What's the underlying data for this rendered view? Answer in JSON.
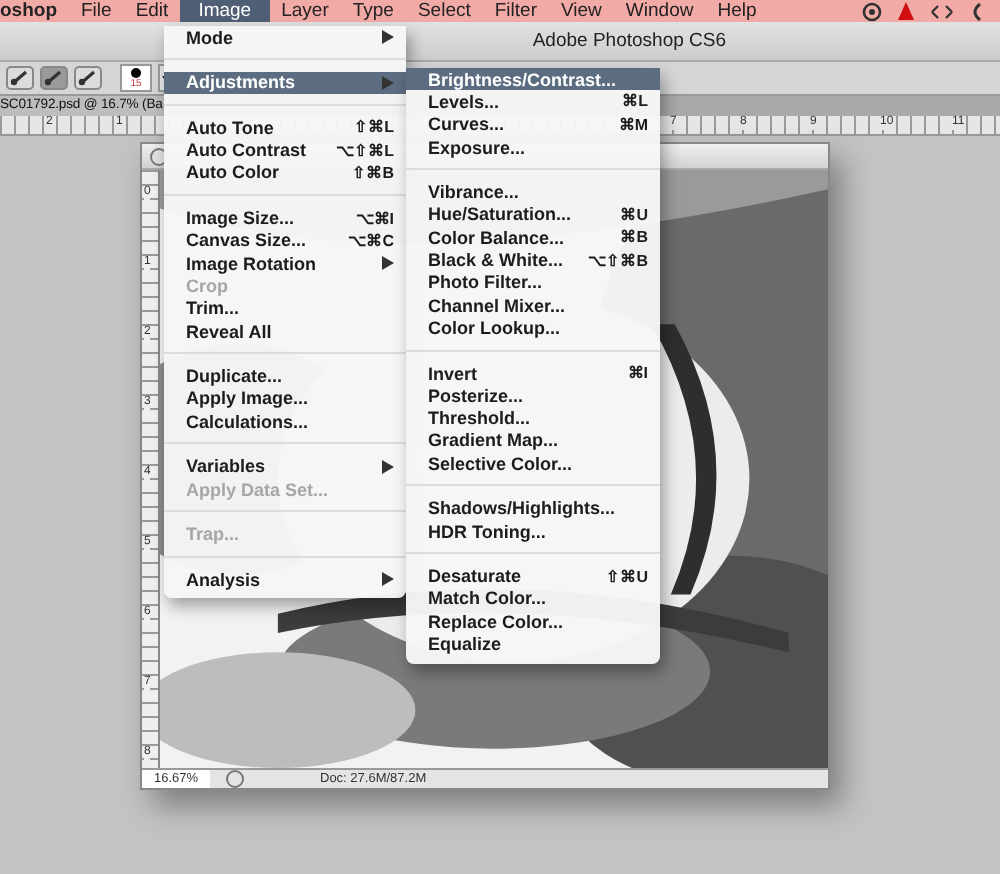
{
  "menu_bar": {
    "items": [
      {
        "label": "oshop",
        "selected": false,
        "kind": "app"
      },
      {
        "label": "File",
        "selected": false,
        "kind": "menu"
      },
      {
        "label": "Edit",
        "selected": false,
        "kind": "menu"
      },
      {
        "label": "Image",
        "selected": true,
        "kind": "menu"
      },
      {
        "label": "Layer",
        "selected": false,
        "kind": "menu"
      },
      {
        "label": "Type",
        "selected": false,
        "kind": "menu"
      },
      {
        "label": "Select",
        "selected": false,
        "kind": "menu"
      },
      {
        "label": "Filter",
        "selected": false,
        "kind": "menu"
      },
      {
        "label": "View",
        "selected": false,
        "kind": "menu"
      },
      {
        "label": "Window",
        "selected": false,
        "kind": "menu"
      },
      {
        "label": "Help",
        "selected": false,
        "kind": "menu"
      }
    ]
  },
  "window": {
    "title": "Adobe Photoshop CS6"
  },
  "options_bar": {
    "brush_size": "15"
  },
  "document_tab": {
    "title": "SC01792.psd @ 16.7% (Ba"
  },
  "top_ruler": [
    "2",
    "1",
    "7",
    "8",
    "9",
    "10",
    "11"
  ],
  "document": {
    "ruler": [
      "0",
      "1",
      "2",
      "3",
      "4",
      "5",
      "6",
      "7",
      "8"
    ],
    "zoom": "16.67%",
    "doc_size": "Doc: 27.6M/87.2M"
  },
  "image_menu": [
    {
      "kind": "item",
      "label": "Mode",
      "submenu": true,
      "disabled": false,
      "selected": false
    },
    {
      "kind": "separator"
    },
    {
      "kind": "item",
      "label": "Adjustments",
      "submenu": true,
      "disabled": false,
      "selected": true
    },
    {
      "kind": "separator"
    },
    {
      "kind": "item",
      "label": "Auto Tone",
      "shortcut": "⇧⌘L",
      "submenu": false,
      "disabled": false,
      "selected": false
    },
    {
      "kind": "item",
      "label": "Auto Contrast",
      "shortcut": "⌥⇧⌘L",
      "submenu": false,
      "disabled": false,
      "selected": false
    },
    {
      "kind": "item",
      "label": "Auto Color",
      "shortcut": "⇧⌘B",
      "submenu": false,
      "disabled": false,
      "selected": false
    },
    {
      "kind": "separator"
    },
    {
      "kind": "item",
      "label": "Image Size...",
      "shortcut": "⌥⌘I",
      "submenu": false,
      "disabled": false,
      "selected": false
    },
    {
      "kind": "item",
      "label": "Canvas Size...",
      "shortcut": "⌥⌘C",
      "submenu": false,
      "disabled": false,
      "selected": false
    },
    {
      "kind": "item",
      "label": "Image Rotation",
      "submenu": true,
      "disabled": false,
      "selected": false
    },
    {
      "kind": "item",
      "label": "Crop",
      "submenu": false,
      "disabled": true,
      "selected": false
    },
    {
      "kind": "item",
      "label": "Trim...",
      "submenu": false,
      "disabled": false,
      "selected": false
    },
    {
      "kind": "item",
      "label": "Reveal All",
      "submenu": false,
      "disabled": false,
      "selected": false
    },
    {
      "kind": "separator"
    },
    {
      "kind": "item",
      "label": "Duplicate...",
      "submenu": false,
      "disabled": false,
      "selected": false
    },
    {
      "kind": "item",
      "label": "Apply Image...",
      "submenu": false,
      "disabled": false,
      "selected": false
    },
    {
      "kind": "item",
      "label": "Calculations...",
      "submenu": false,
      "disabled": false,
      "selected": false
    },
    {
      "kind": "separator"
    },
    {
      "kind": "item",
      "label": "Variables",
      "submenu": true,
      "disabled": false,
      "selected": false
    },
    {
      "kind": "item",
      "label": "Apply Data Set...",
      "submenu": false,
      "disabled": true,
      "selected": false
    },
    {
      "kind": "separator"
    },
    {
      "kind": "item",
      "label": "Trap...",
      "submenu": false,
      "disabled": true,
      "selected": false
    },
    {
      "kind": "separator"
    },
    {
      "kind": "item",
      "label": "Analysis",
      "submenu": true,
      "disabled": false,
      "selected": false
    }
  ],
  "adjustments_menu": [
    {
      "kind": "item",
      "label": "Brightness/Contrast...",
      "disabled": false,
      "selected": true
    },
    {
      "kind": "item",
      "label": "Levels...",
      "shortcut": "⌘L",
      "disabled": false,
      "selected": false
    },
    {
      "kind": "item",
      "label": "Curves...",
      "shortcut": "⌘M",
      "disabled": false,
      "selected": false
    },
    {
      "kind": "item",
      "label": "Exposure...",
      "disabled": false,
      "selected": false
    },
    {
      "kind": "separator"
    },
    {
      "kind": "item",
      "label": "Vibrance...",
      "disabled": false,
      "selected": false
    },
    {
      "kind": "item",
      "label": "Hue/Saturation...",
      "shortcut": "⌘U",
      "disabled": false,
      "selected": false
    },
    {
      "kind": "item",
      "label": "Color Balance...",
      "shortcut": "⌘B",
      "disabled": false,
      "selected": false
    },
    {
      "kind": "item",
      "label": "Black & White...",
      "shortcut": "⌥⇧⌘B",
      "disabled": false,
      "selected": false
    },
    {
      "kind": "item",
      "label": "Photo Filter...",
      "disabled": false,
      "selected": false
    },
    {
      "kind": "item",
      "label": "Channel Mixer...",
      "disabled": false,
      "selected": false
    },
    {
      "kind": "item",
      "label": "Color Lookup...",
      "disabled": false,
      "selected": false
    },
    {
      "kind": "separator"
    },
    {
      "kind": "item",
      "label": "Invert",
      "shortcut": "⌘I",
      "disabled": false,
      "selected": false
    },
    {
      "kind": "item",
      "label": "Posterize...",
      "disabled": false,
      "selected": false
    },
    {
      "kind": "item",
      "label": "Threshold...",
      "disabled": false,
      "selected": false
    },
    {
      "kind": "item",
      "label": "Gradient Map...",
      "disabled": false,
      "selected": false
    },
    {
      "kind": "item",
      "label": "Selective Color...",
      "disabled": false,
      "selected": false
    },
    {
      "kind": "separator"
    },
    {
      "kind": "item",
      "label": "Shadows/Highlights...",
      "disabled": false,
      "selected": false
    },
    {
      "kind": "item",
      "label": "HDR Toning...",
      "disabled": false,
      "selected": false
    },
    {
      "kind": "separator"
    },
    {
      "kind": "item",
      "label": "Desaturate",
      "shortcut": "⇧⌘U",
      "disabled": false,
      "selected": false
    },
    {
      "kind": "item",
      "label": "Match Color...",
      "disabled": false,
      "selected": false
    },
    {
      "kind": "item",
      "label": "Replace Color...",
      "disabled": false,
      "selected": false
    },
    {
      "kind": "item",
      "label": "Equalize",
      "disabled": false,
      "selected": false
    }
  ]
}
